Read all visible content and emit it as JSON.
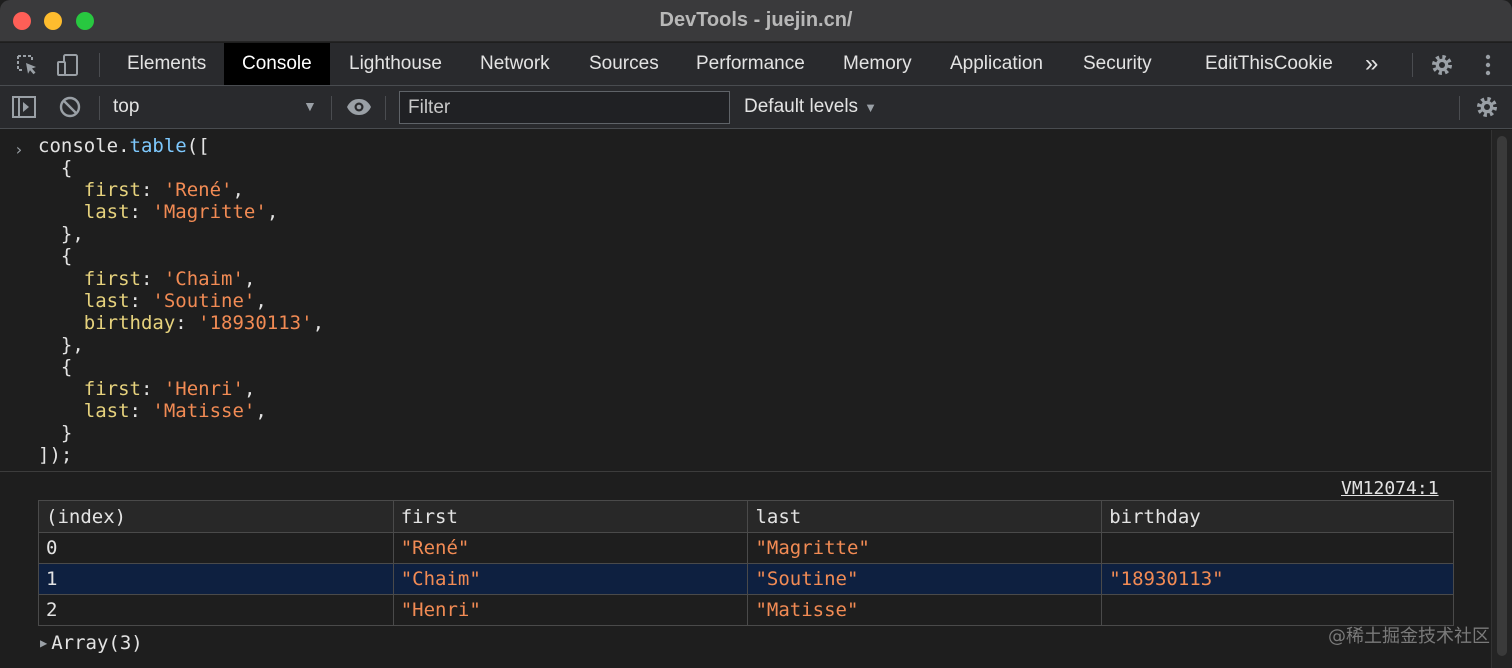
{
  "window": {
    "title": "DevTools - juejin.cn/"
  },
  "tabs": [
    {
      "label": "Elements",
      "active": false
    },
    {
      "label": "Console",
      "active": true
    },
    {
      "label": "Lighthouse",
      "active": false
    },
    {
      "label": "Network",
      "active": false
    },
    {
      "label": "Sources",
      "active": false
    },
    {
      "label": "Performance",
      "active": false
    },
    {
      "label": "Memory",
      "active": false
    },
    {
      "label": "Application",
      "active": false
    },
    {
      "label": "Security",
      "active": false
    },
    {
      "label": "EditThisCookie",
      "active": false
    }
  ],
  "overflow_label": "»",
  "toolbar": {
    "context": "top",
    "filter_placeholder": "Filter",
    "levels": "Default levels"
  },
  "console": {
    "prompt": "›",
    "code": {
      "call_obj": "console",
      "call_fn": "table",
      "objects": [
        [
          {
            "key": "first",
            "value": "'René'"
          },
          {
            "key": "last",
            "value": "'Magritte'"
          }
        ],
        [
          {
            "key": "first",
            "value": "'Chaim'"
          },
          {
            "key": "last",
            "value": "'Soutine'"
          },
          {
            "key": "birthday",
            "value": "'18930113'"
          }
        ],
        [
          {
            "key": "first",
            "value": "'Henri'"
          },
          {
            "key": "last",
            "value": "'Matisse'"
          }
        ]
      ]
    },
    "source_link": "VM12074:1",
    "table": {
      "headers": [
        "(index)",
        "first",
        "last",
        "birthday"
      ],
      "rows": [
        [
          "0",
          "\"René\"",
          "\"Magritte\"",
          ""
        ],
        [
          "1",
          "\"Chaim\"",
          "\"Soutine\"",
          "\"18930113\""
        ],
        [
          "2",
          "\"Henri\"",
          "\"Matisse\"",
          ""
        ]
      ],
      "selected_row": 1
    },
    "array_summary": "Array(3)"
  },
  "watermark": "@稀土掘金技术社区",
  "colors": {
    "string": "#f28b54",
    "property": "#e6d27d",
    "function": "#7ec9fe",
    "selected_row": "#0e2040",
    "active_tab": "#000000"
  }
}
